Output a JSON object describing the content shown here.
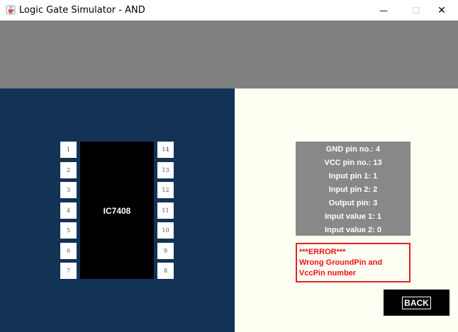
{
  "window": {
    "title": "Logic Gate Simulator - AND",
    "app_icon": "java-coffee-icon",
    "minimize_glyph": "—",
    "maximize_glyph": "☐",
    "close_glyph": "✕"
  },
  "chip": {
    "label": "IC7408",
    "left_pins": [
      "1",
      "2",
      "3",
      "4",
      "5",
      "6",
      "7"
    ],
    "right_pins": [
      "14",
      "13",
      "12",
      "11",
      "10",
      "9",
      "8"
    ]
  },
  "info": {
    "gnd_pin": "GND pin no.: 4",
    "vcc_pin": "VCC pin no.: 13",
    "input_pin_1": "Input pin 1: 1",
    "input_pin_2": "Input pin 2: 2",
    "output_pin": "Output pin: 3",
    "input_value_1": "Input value 1: 1",
    "input_value_2": "Input value 2: 0"
  },
  "error": {
    "line1": "***ERROR***",
    "line2": "Wrong GroundPin and",
    "line3": "VccPin number"
  },
  "back_button": "BACK",
  "colors": {
    "top_band": "#808080",
    "left_panel": "#123256",
    "right_panel": "#fffff4",
    "info_bg": "#888888",
    "error": "#ee1111"
  }
}
